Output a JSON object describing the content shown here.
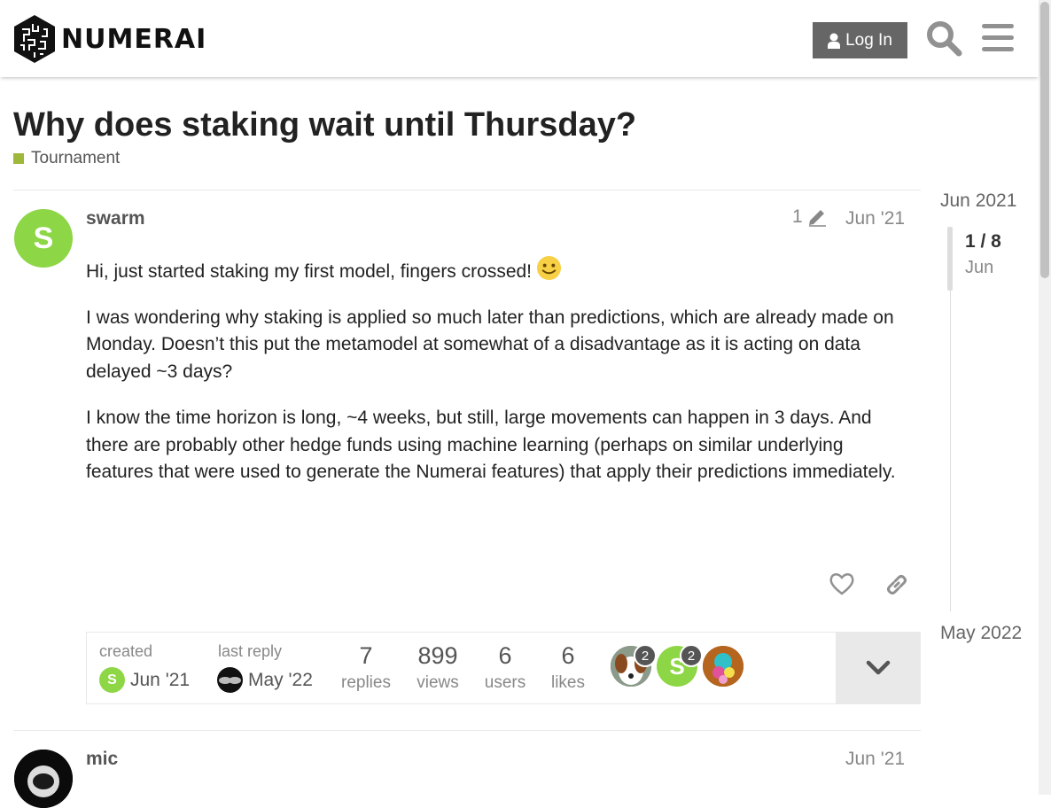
{
  "header": {
    "brand": "NUMERAI",
    "login_label": "Log In"
  },
  "topic": {
    "title": "Why does staking wait until Thursday?",
    "category": "Tournament",
    "category_color": "#9eb83b"
  },
  "posts": [
    {
      "author": "swarm",
      "avatar_letter": "S",
      "avatar_color": "#8dd645",
      "edit_count": "1",
      "date": "Jun '21",
      "paragraphs": [
        "Hi, just started staking my first model, fingers crossed!",
        "I was wondering why staking is applied so much later than predictions, which are already made on Monday. Doesn’t this put the metamodel at somewhat of a disadvantage as it is acting on data delayed ~3 days?",
        "I know the time horizon is long, ~4 weeks, but still, large movements can happen in 3 days. And there are probably other hedge funds using machine learning (perhaps on similar underlying features that were used to generate the Numerai features) that apply their predictions immediately."
      ]
    },
    {
      "author": "mic",
      "date": "Jun '21"
    }
  ],
  "topic_map": {
    "created_label": "created",
    "created_date": "Jun '21",
    "last_reply_label": "last reply",
    "last_reply_date": "May '22",
    "stats": [
      {
        "value": "7",
        "label": "replies"
      },
      {
        "value": "899",
        "label": "views"
      },
      {
        "value": "6",
        "label": "users"
      },
      {
        "value": "6",
        "label": "likes"
      }
    ],
    "participants": [
      {
        "name": "dog-avatar",
        "count": "2"
      },
      {
        "name": "swarm-avatar",
        "letter": "S",
        "count": "2"
      },
      {
        "name": "colorful-avatar"
      }
    ]
  },
  "timeline": {
    "start": "Jun 2021",
    "position": "1 / 8",
    "position_date": "Jun",
    "end": "May 2022"
  }
}
